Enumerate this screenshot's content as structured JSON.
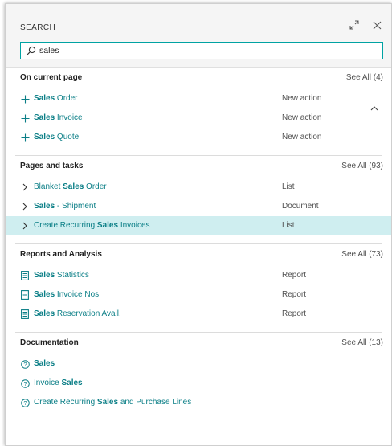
{
  "header": {
    "title": "SEARCH",
    "expand_icon": "expand-arrows-icon",
    "close_icon": "close-icon"
  },
  "search": {
    "value": "sales",
    "icon": "search-icon"
  },
  "sections": [
    {
      "title": "On current page",
      "see_all": "See All (4)",
      "items": [
        {
          "prefix": "",
          "bold": "Sales",
          "suffix": " Order",
          "type": "New action",
          "icon": "plus-icon"
        },
        {
          "prefix": "",
          "bold": "Sales",
          "suffix": " Invoice",
          "type": "New action",
          "icon": "plus-icon"
        },
        {
          "prefix": "",
          "bold": "Sales",
          "suffix": " Quote",
          "type": "New action",
          "icon": "plus-icon"
        }
      ]
    },
    {
      "title": "Pages and tasks",
      "see_all": "See All (93)",
      "items": [
        {
          "prefix": "Blanket ",
          "bold": "Sales",
          "suffix": " Order",
          "type": "List",
          "icon": "chevron-right-icon"
        },
        {
          "prefix": "",
          "bold": "Sales",
          "suffix": " - Shipment",
          "type": "Document",
          "icon": "chevron-right-icon"
        },
        {
          "prefix": "Create Recurring ",
          "bold": "Sales",
          "suffix": " Invoices",
          "type": "List",
          "icon": "chevron-right-icon"
        }
      ]
    },
    {
      "title": "Reports and Analysis",
      "see_all": "See All (73)",
      "items": [
        {
          "prefix": "",
          "bold": "Sales",
          "suffix": " Statistics",
          "type": "Report",
          "icon": "report-icon"
        },
        {
          "prefix": "",
          "bold": "Sales",
          "suffix": " Invoice Nos.",
          "type": "Report",
          "icon": "report-icon"
        },
        {
          "prefix": "",
          "bold": "Sales",
          "suffix": " Reservation Avail.",
          "type": "Report",
          "icon": "report-icon"
        }
      ]
    },
    {
      "title": "Documentation",
      "see_all": "See All (13)",
      "items": [
        {
          "prefix": "",
          "bold": "Sales",
          "suffix": "",
          "type": "",
          "icon": "help-icon"
        },
        {
          "prefix": "Invoice ",
          "bold": "Sales",
          "suffix": "",
          "type": "",
          "icon": "help-icon"
        },
        {
          "prefix": "Create Recurring ",
          "bold": "Sales",
          "suffix": " and Purchase Lines",
          "type": "",
          "icon": "help-icon"
        }
      ]
    }
  ],
  "colors": {
    "accent": "#00a3a3",
    "link": "#0a7e86",
    "highlight": "#cfeef0"
  }
}
